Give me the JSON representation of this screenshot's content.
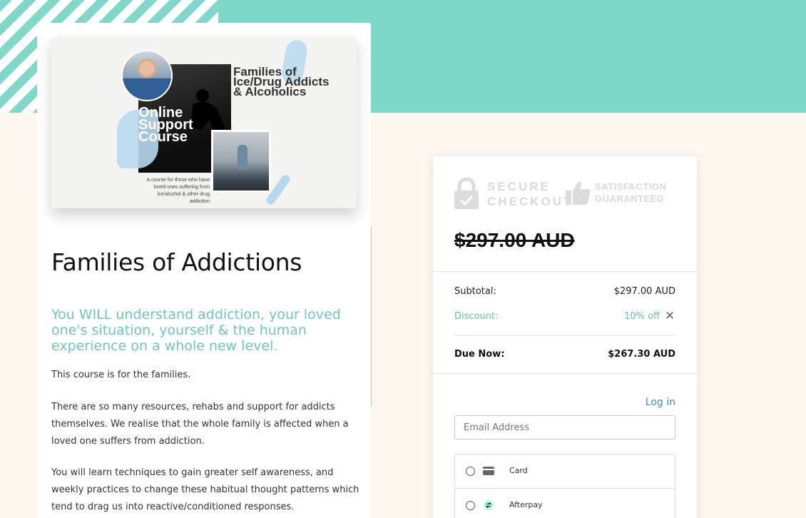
{
  "course": {
    "banner": {
      "title_right": "Families of Ice/Drug Addicts & Alcoholics",
      "title_left": "Online Support Course",
      "caption": "A course for those who have loved ones suffering from ice/alcohol & other drug addiction"
    },
    "title": "Families of Addictions",
    "subtitle": "You WILL understand addiction, your loved one's situation, yourself & the human experience on a whole new level.",
    "paragraphs": [
      "This course is for the families.",
      "There are so many resources, rehabs and support for addicts themselves. We realise that the whole family is affected when a loved one suffers from addiction.",
      "You will learn techniques to gain greater self awareness, and weekly practices to change these habitual thought patterns which tend to drag us into reactive/conditioned responses."
    ]
  },
  "checkout": {
    "badges": {
      "secure_line1": "SECURE",
      "secure_line2": "CHECKOUT",
      "satisfaction_line1": "SATISFACTION",
      "satisfaction_line2": "GUARANTEED"
    },
    "original_price": "$297.00 AUD",
    "subtotal_label": "Subtotal:",
    "subtotal_value": "$297.00 AUD",
    "discount_label": "Discount:",
    "discount_value": "10% off",
    "remove_discount_glyph": "✕",
    "due_label": "Due Now:",
    "due_value": "$267.30 AUD",
    "login_label": "Log in",
    "email_placeholder": "Email Address",
    "payment_options": [
      {
        "label": "Card",
        "icon": "credit-card-icon"
      },
      {
        "label": "Afterpay",
        "icon": "afterpay-icon"
      }
    ]
  },
  "colors": {
    "teal": "#7dd8c8",
    "accent_text": "#6cc9b6",
    "link": "#3d8bb7",
    "page_bg": "#fdf7ef"
  }
}
